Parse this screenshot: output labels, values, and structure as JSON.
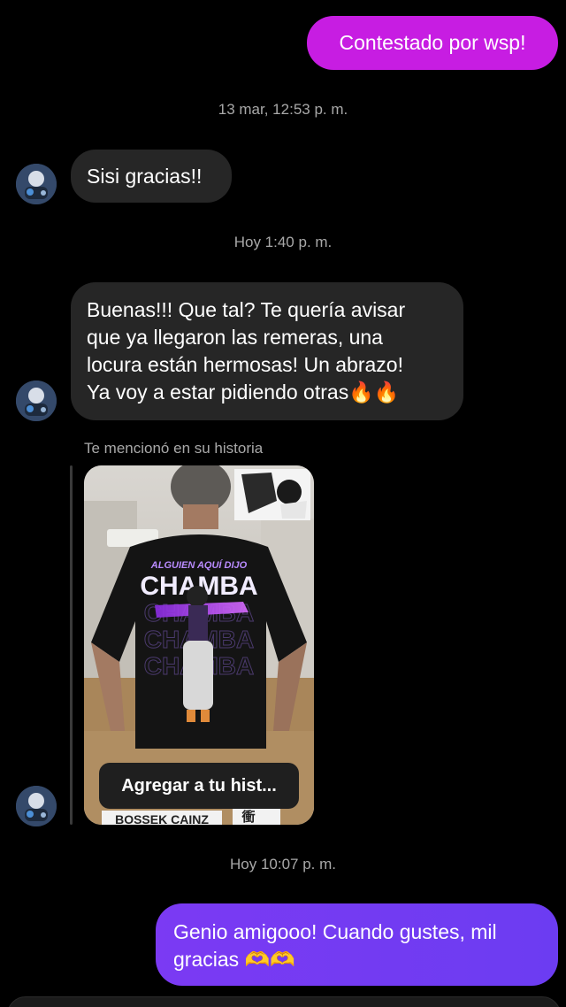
{
  "messages": {
    "sent_1": "Contestado por wsp!",
    "timestamp_1": "13 mar, 12:53 p. m.",
    "received_1": "Sisi gracias!!",
    "timestamp_2": "Hoy 1:40 p. m.",
    "received_2_lines": [
      "Buenas!!! Que tal? Te quería avisar",
      "que ya llegaron las remeras, una",
      "locura están hermosas! Un abrazo!",
      "Ya voy a estar pidiendo otras🔥🔥"
    ],
    "mention_label": "Te mencionó en su historia",
    "timestamp_3": "Hoy 10:07 p. m.",
    "sent_2": "Genio amigooo! Cuando gustes, mil gracias 🫶🫶"
  },
  "story": {
    "add_to_story_label": "Agregar a tu hist...",
    "shirt_line_1": "ALGUIEN AQUÍ DIJO",
    "shirt_line_2": "CHAMBA",
    "shirt_echo": "CHAMBA",
    "sign_text": "BOSSEK CAINZ",
    "corner_sign": "衝"
  },
  "colors": {
    "sent_pink": "#c71de2",
    "sent_violet": "#7b3af3",
    "received_bubble": "#262626",
    "background": "#000000",
    "muted_text": "#a8a8a8"
  },
  "icons": {
    "avatar": "user-avatar",
    "add_story": "add-to-story-button"
  }
}
